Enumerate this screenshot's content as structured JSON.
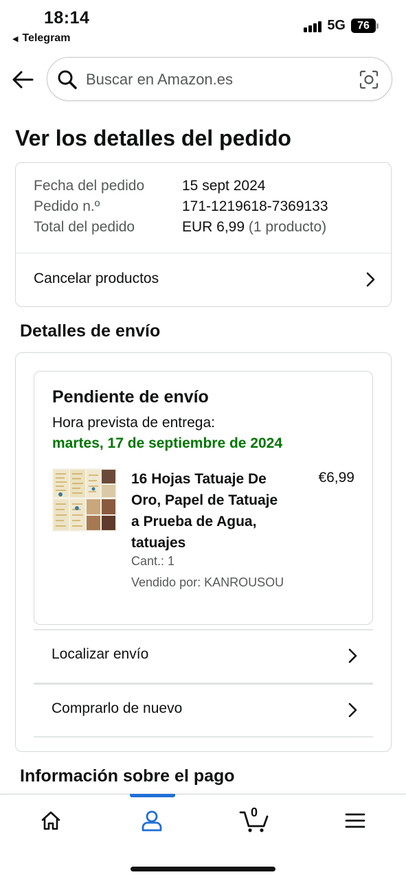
{
  "status_bar": {
    "time": "18:14",
    "back_app": "Telegram",
    "network": "5G",
    "battery": "76"
  },
  "search": {
    "placeholder": "Buscar en Amazon.es"
  },
  "page_title": "Ver los detalles del pedido",
  "order": {
    "rows": [
      {
        "label": "Fecha del pedido",
        "value": "15 sept 2024"
      },
      {
        "label": "Pedido n.º",
        "value": "171-1219618-7369133"
      },
      {
        "label": "Total del pedido",
        "value": "EUR 6,99",
        "extra": "(1 producto)"
      }
    ],
    "cancel_label": "Cancelar productos"
  },
  "shipping": {
    "section_title": "Detalles de envío",
    "status_title": "Pendiente de envío",
    "eta_label": "Hora prevista de entrega:",
    "eta_date": "martes, 17 de septiembre de 2024",
    "eta_color": "#007600",
    "product": {
      "title": "16 Hojas Tatuaje De Oro, Papel de Tatuaje a Prueba de Agua, tatuajes",
      "price": "€6,99",
      "quantity": "Cant.: 1",
      "seller": "Vendido por: KANROUSOU"
    },
    "links": [
      "Localizar envío",
      "Comprarlo de nuevo"
    ]
  },
  "payment": {
    "section_title": "Información sobre el pago"
  },
  "bottom_nav": {
    "items": [
      "home-icon",
      "account-icon",
      "cart-icon",
      "menu-icon"
    ],
    "cart_count": "0",
    "active_color": "#1f6fd6"
  }
}
